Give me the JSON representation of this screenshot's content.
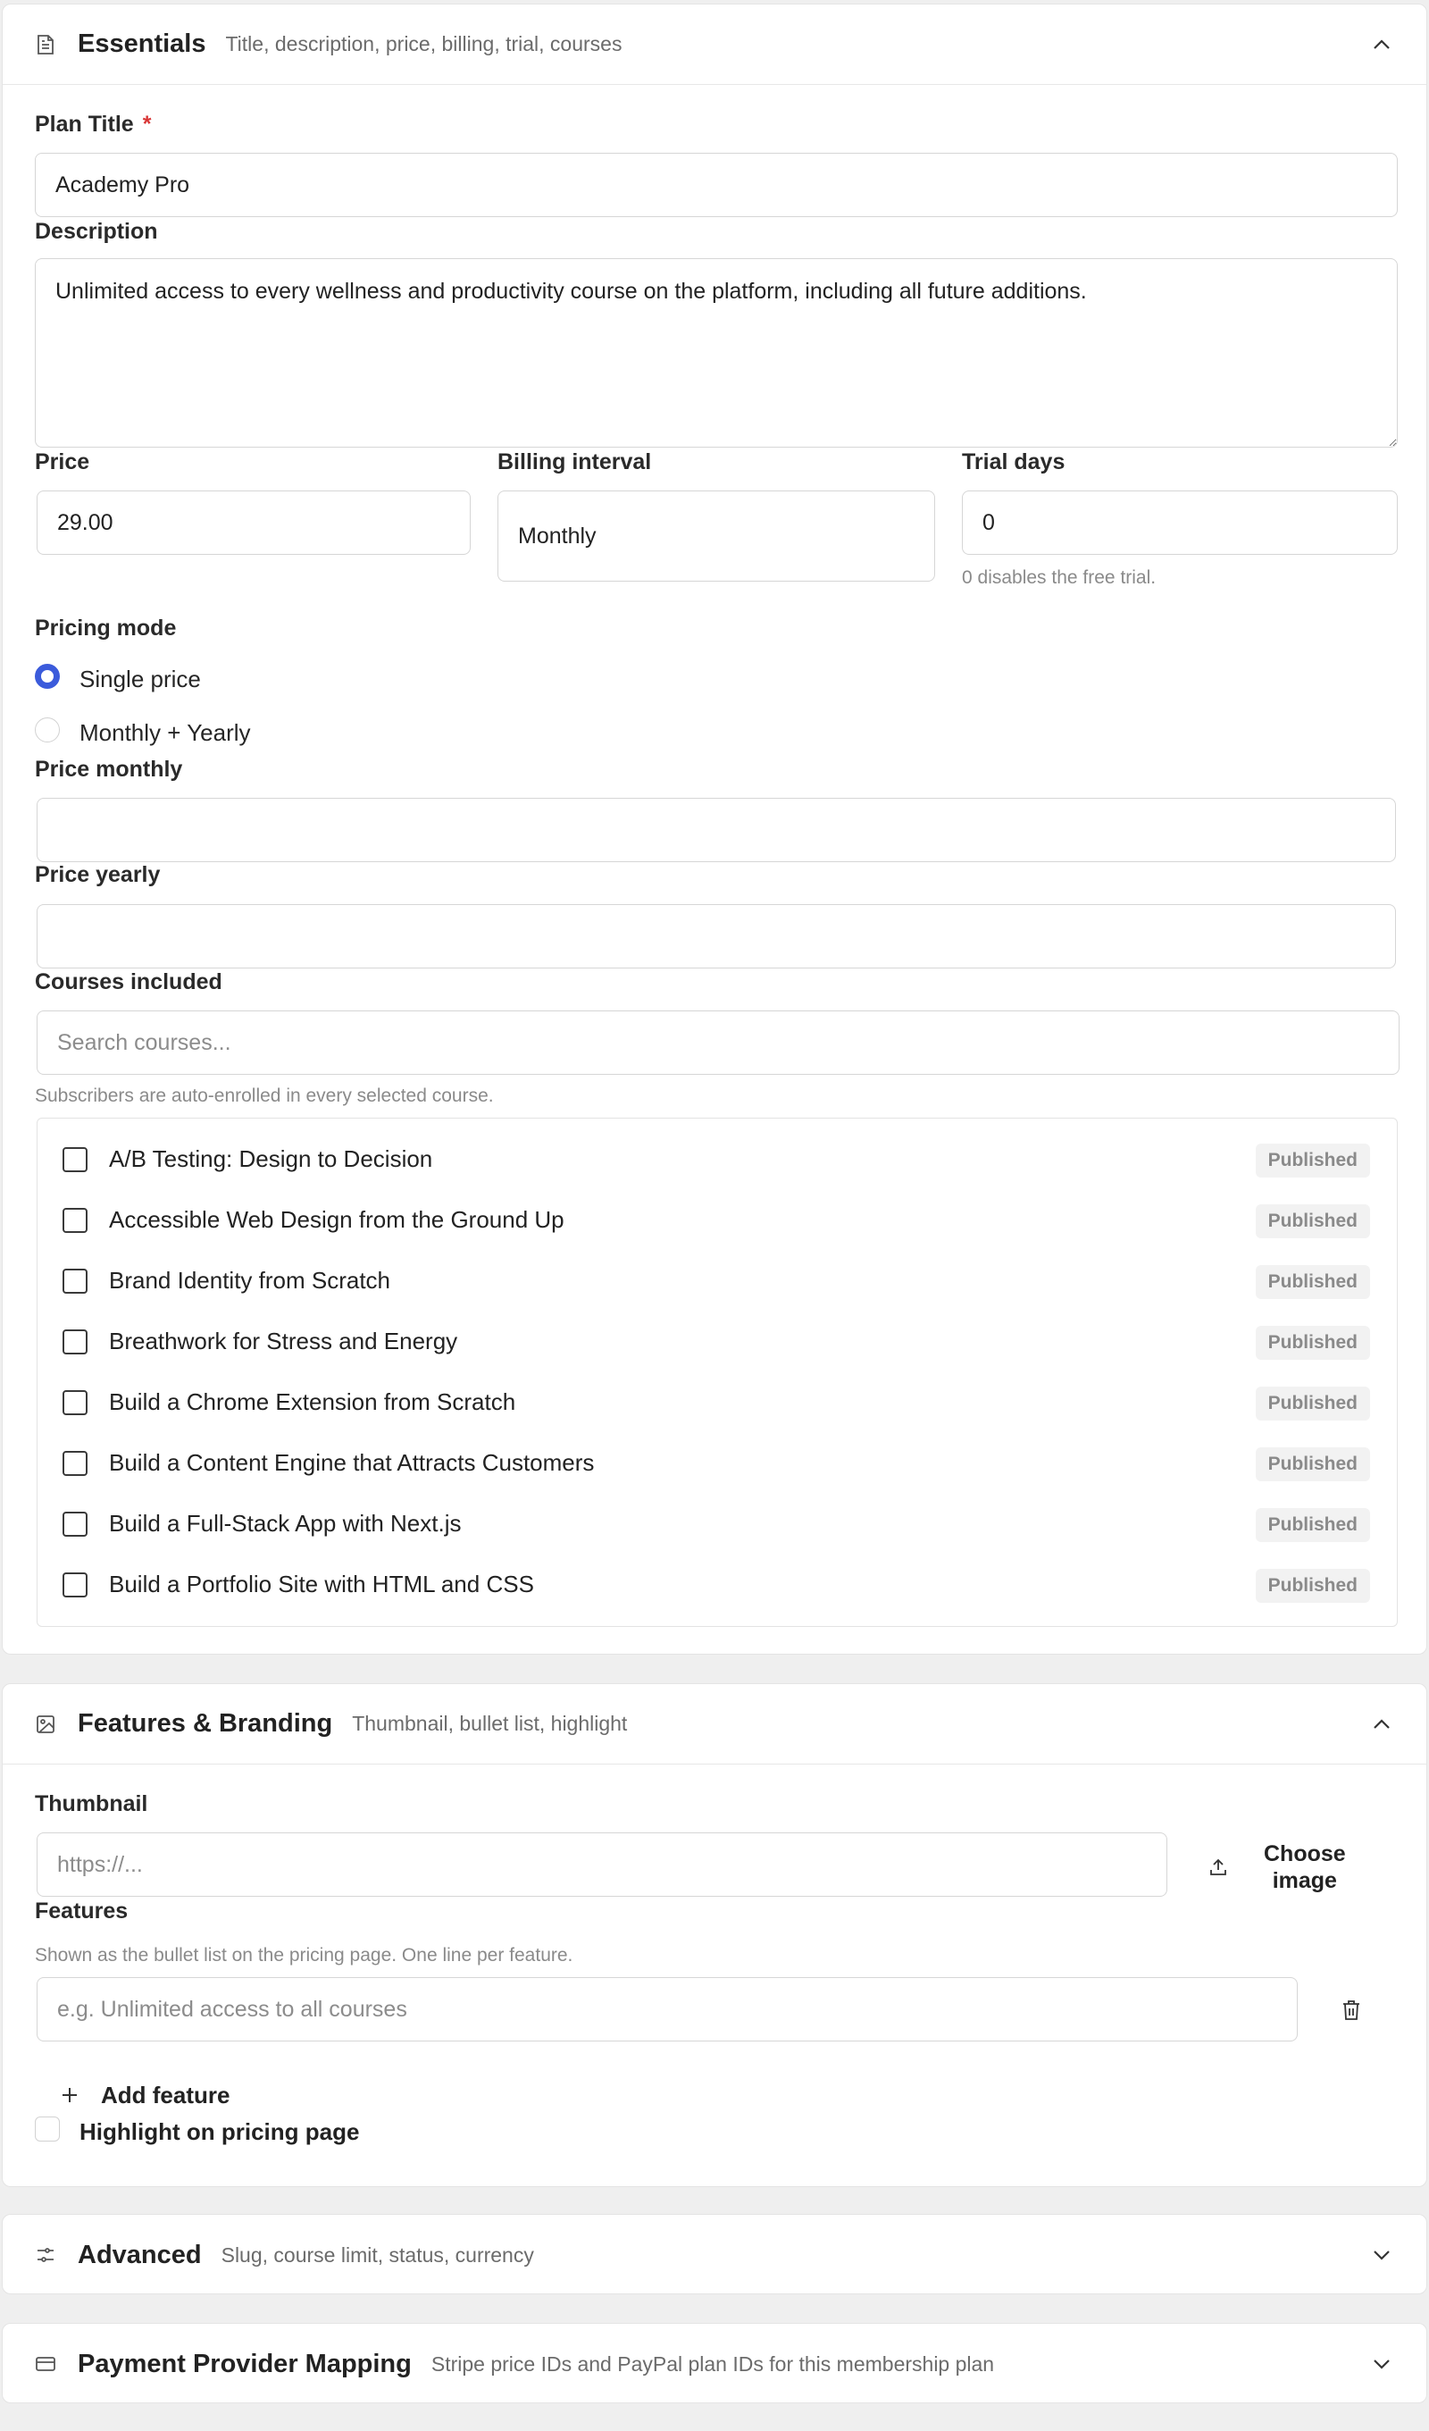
{
  "essentials": {
    "title": "Essentials",
    "subtitle": "Title, description, price, billing, trial, courses",
    "plan_title_label": "Plan Title",
    "required_mark": "*",
    "plan_title_value": "Academy Pro",
    "description_label": "Description",
    "description_value": "Unlimited access to every wellness and productivity course on the platform, including all future additions.",
    "price_label": "Price",
    "price_value": "29.00",
    "billing_label": "Billing interval",
    "billing_value": "Monthly",
    "trial_label": "Trial days",
    "trial_value": "0",
    "trial_help": "0 disables the free trial.",
    "pricing_mode_label": "Pricing mode",
    "pricing_options": [
      {
        "label": "Single price",
        "selected": true
      },
      {
        "label": "Monthly + Yearly",
        "selected": false
      }
    ],
    "price_monthly_label": "Price monthly",
    "price_monthly_value": "",
    "price_yearly_label": "Price yearly",
    "price_yearly_value": "",
    "courses_label": "Courses included",
    "courses_search_placeholder": "Search courses...",
    "courses_help": "Subscribers are auto-enrolled in every selected course.",
    "courses": [
      {
        "name": "A/B Testing: Design to Decision",
        "status": "Published"
      },
      {
        "name": "Accessible Web Design from the Ground Up",
        "status": "Published"
      },
      {
        "name": "Brand Identity from Scratch",
        "status": "Published"
      },
      {
        "name": "Breathwork for Stress and Energy",
        "status": "Published"
      },
      {
        "name": "Build a Chrome Extension from Scratch",
        "status": "Published"
      },
      {
        "name": "Build a Content Engine that Attracts Customers",
        "status": "Published"
      },
      {
        "name": "Build a Full-Stack App with Next.js",
        "status": "Published"
      },
      {
        "name": "Build a Portfolio Site with HTML and CSS",
        "status": "Published"
      }
    ]
  },
  "features": {
    "title": "Features & Branding",
    "subtitle": "Thumbnail, bullet list, highlight",
    "thumbnail_label": "Thumbnail",
    "thumbnail_placeholder": "https://...",
    "choose_image_line1": "Choose",
    "choose_image_line2": "image",
    "features_label": "Features",
    "features_help": "Shown as the bullet list on the pricing page. One line per feature.",
    "feature_placeholder": "e.g. Unlimited access to all courses",
    "add_feature_label": "Add feature",
    "highlight_label": "Highlight on pricing page"
  },
  "advanced": {
    "title": "Advanced",
    "subtitle": "Slug, course limit, status, currency"
  },
  "payment": {
    "title": "Payment Provider Mapping",
    "subtitle": "Stripe price IDs and PayPal plan IDs for this membership plan"
  },
  "colors": {
    "accent": "#3b5bdb",
    "danger": "#d93636",
    "badge_bg": "#f2f2f2"
  }
}
